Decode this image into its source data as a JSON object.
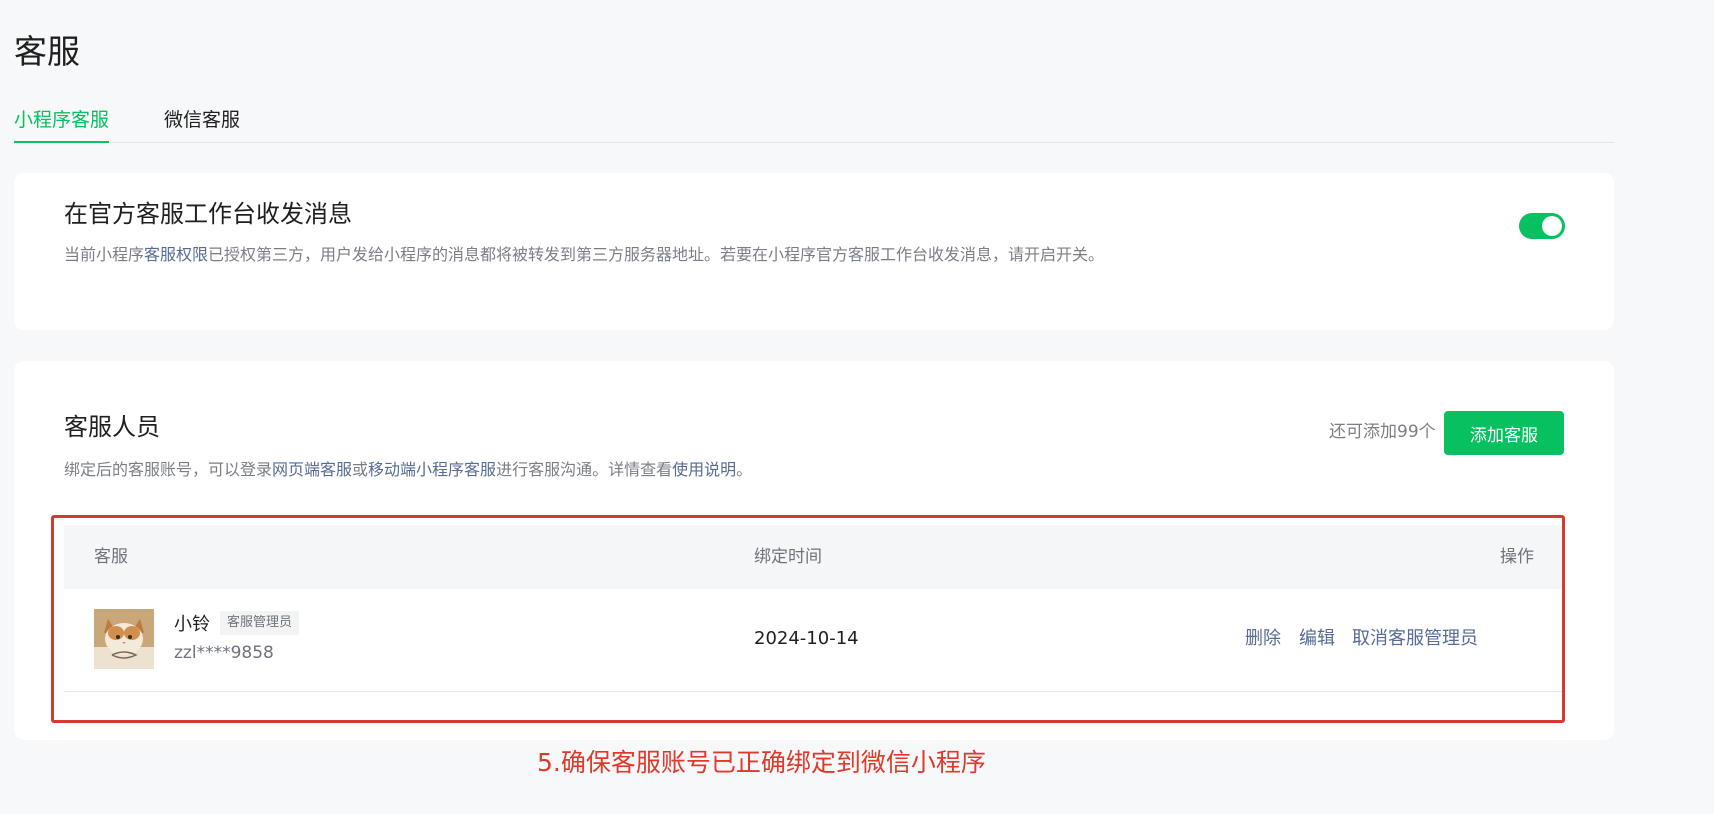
{
  "page": {
    "title": "客服"
  },
  "tabs": [
    {
      "label": "小程序客服",
      "active": true
    },
    {
      "label": "微信客服",
      "active": false
    }
  ],
  "workbench": {
    "title": "在官方客服工作台收发消息",
    "desc_before": "当前小程序",
    "desc_link": "客服权限",
    "desc_after": "已授权第三方，用户发给小程序的消息都将被转发到第三方服务器地址。若要在小程序官方客服工作台收发消息，请开启开关。",
    "toggle_on": true
  },
  "staff": {
    "title": "客服人员",
    "desc_before": "绑定后的客服账号，可以登录",
    "desc_link1": "网页端客服",
    "desc_mid": "或",
    "desc_link2": "移动端小程序客服",
    "desc_after": "进行客服沟通。详情查看",
    "desc_link3": "使用说明",
    "desc_end": "。",
    "remaining": "还可添加99个",
    "add_button": "添加客服",
    "columns": {
      "agent": "客服",
      "bind_time": "绑定时间",
      "actions": "操作"
    },
    "rows": [
      {
        "name": "小铃",
        "role": "客服管理员",
        "account": "zzl****9858",
        "bind_time": "2024-10-14",
        "actions": {
          "delete": "删除",
          "edit": "编辑",
          "cancel_admin": "取消客服管理员"
        }
      }
    ]
  },
  "annotation": "5.确保客服账号已正确绑定到微信小程序",
  "colors": {
    "accent": "#07c160",
    "link": "#576b95",
    "annotation": "#e0392b"
  }
}
